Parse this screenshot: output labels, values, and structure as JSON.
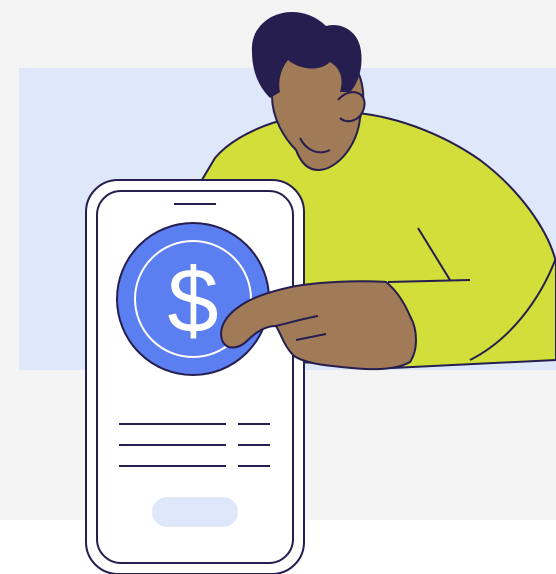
{
  "illustration": {
    "icon": "dollar-coin-icon",
    "symbol": "$",
    "colors": {
      "panel_background": "#f4f4f4",
      "backdrop": "#dfe8fb",
      "sweater": "#d2df3a",
      "skin": "#a17a57",
      "hair": "#251e4f",
      "outline": "#251e4f",
      "phone_body": "#ffffff",
      "coin": "#5b7ef0",
      "coin_symbol": "#ffffff",
      "phone_button": "#dfe8fb"
    }
  }
}
